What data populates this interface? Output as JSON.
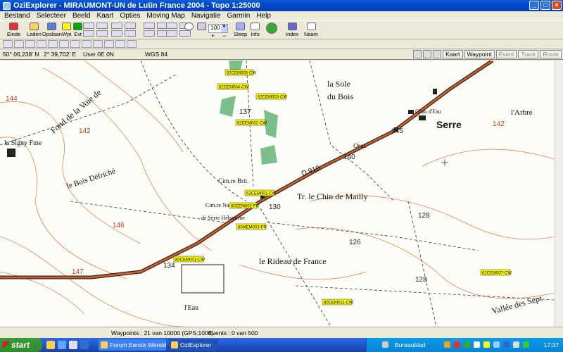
{
  "window": {
    "title": "OziExplorer - MIRAUMONT-UN de Lutin France 2004 - Topo 1:25000"
  },
  "menu": [
    "Bestand",
    "Selecteer",
    "Beeld",
    "Kaart",
    "Opties",
    "Moving Map",
    "Navigatie",
    "Garmin",
    "Help"
  ],
  "toolbar": {
    "einde": "Einde",
    "laden": "Laden",
    "opslaan": "Opslaan",
    "wpt": "Wpt",
    "evt": "Evt",
    "zoom_value": "100",
    "sleep": "Sleep",
    "info": "Info",
    "index": "Index",
    "naam": "Naam"
  },
  "coords": {
    "lat": "50° 06,238' N",
    "lon": "2° 39,702' E",
    "user": "User 0E  0N",
    "datum": "WGS 84"
  },
  "map_tabs": [
    "Kaart",
    "Waypoint",
    "Event",
    "Track",
    "Route"
  ],
  "map": {
    "place_labels": [
      "la Signy Fme",
      "Fond de la Voie de",
      "le Bois Défriché",
      "la Sole",
      "du Bois",
      "l'Arbre",
      "Serre",
      "D 919",
      "Tr. le Chin de Mailly",
      "le Rideau de France",
      "Vallée des Sept",
      "Orat.",
      "Cim.re Brit.",
      "Cim.re Nat.",
      "de Serre Hébuterne",
      "Chau d'Eau",
      "l'Eau"
    ],
    "contours": [
      "144",
      "142",
      "137",
      "140",
      "145",
      "142",
      "146",
      "130",
      "128",
      "126",
      "147",
      "134",
      "128"
    ],
    "waypoints": [
      "62CEM005-CW",
      "62CEM004-CW",
      "62CEM003-CW",
      "62CEM002-CW",
      "62CEM001-CW",
      "80CEM002-FR",
      "80MEM003-FR",
      "80CEM001-CW",
      "62CEM007-CW",
      "80CEM011-CW"
    ]
  },
  "status": {
    "waypoints": "Waypoints : 21 van 10000  (GPS:1000)",
    "events": "Events : 0 van 500"
  },
  "taskbar": {
    "start": "start",
    "tasks": [
      "Forum Eerste Wereld...",
      "OziExplorer"
    ],
    "tray_label": "Bureaublad",
    "clock": "17:37"
  }
}
